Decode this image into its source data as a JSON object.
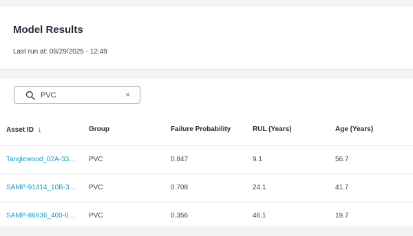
{
  "header": {
    "title": "Model Results",
    "last_run": "Last run at: 08/29/2025 - 12:49"
  },
  "search": {
    "value": "PVC",
    "placeholder": "",
    "clear_glyph": "×",
    "icon": "search-icon"
  },
  "table": {
    "columns": [
      "Asset ID",
      "Group",
      "Failure Probability",
      "RUL (Years)",
      "Age (Years)"
    ],
    "sort_glyph": "↓",
    "rows": [
      {
        "asset_id": "Tanglewood_02A-33...",
        "group": "PVC",
        "failure_probability": "0.847",
        "rul": "9.1",
        "age": "56.7"
      },
      {
        "asset_id": "SAMP-91414_10B-3...",
        "group": "PVC",
        "failure_probability": "0.708",
        "rul": "24.1",
        "age": "41.7"
      },
      {
        "asset_id": "SAMP-86936_400-0...",
        "group": "PVC",
        "failure_probability": "0.356",
        "rul": "46.1",
        "age": "19.7"
      }
    ]
  },
  "colors": {
    "link": "#0e9bc4",
    "background": "#f3f4f6",
    "card": "#ffffff"
  }
}
